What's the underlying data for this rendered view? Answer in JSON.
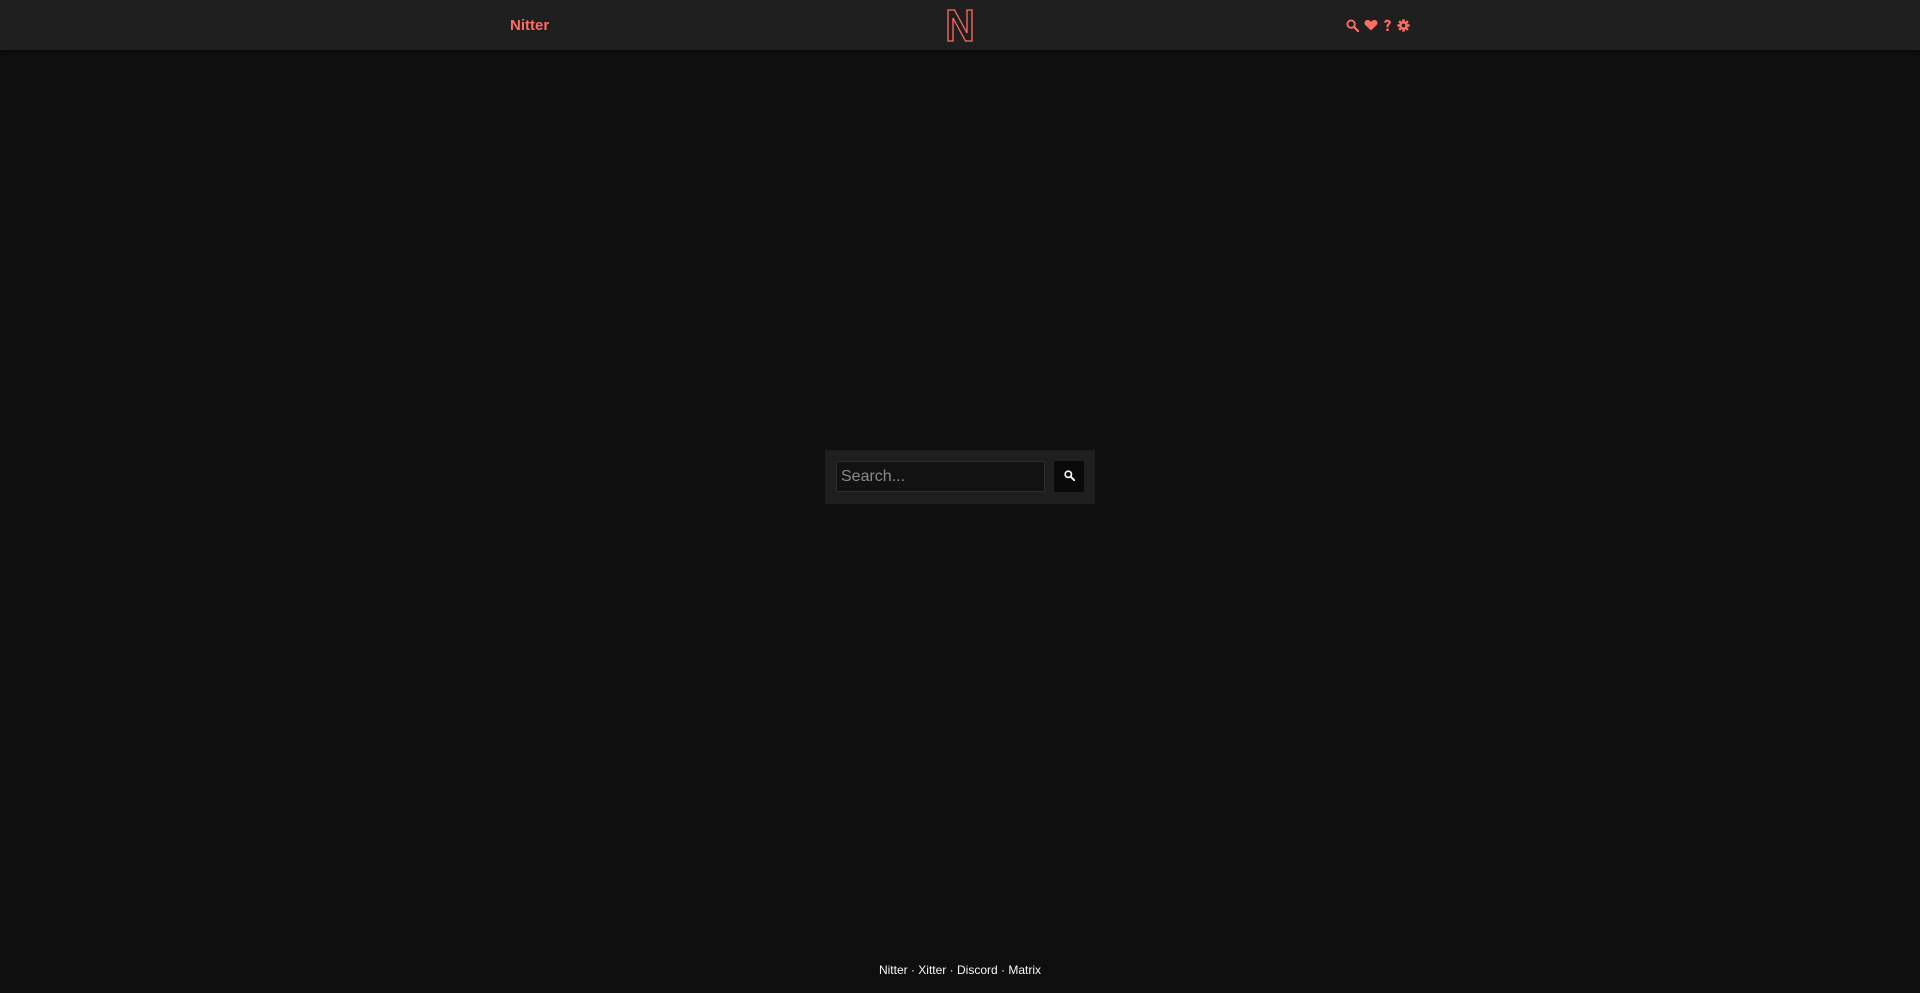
{
  "navbar": {
    "brand_label": "Nitter",
    "logo_icon": "nitter-n-logo-icon",
    "icons": [
      "search-icon",
      "heart-icon",
      "help-icon",
      "gear-icon"
    ]
  },
  "search": {
    "placeholder": "Search...",
    "button_icon": "search-icon"
  },
  "footer": {
    "links": [
      "Nitter",
      "Xitter",
      "Discord",
      "Matrix"
    ],
    "separator": "·"
  },
  "colors": {
    "accent": "#ff6c60",
    "background": "#0f0f0f",
    "panel": "#1f1f1f",
    "text": "#f8f8f2"
  }
}
